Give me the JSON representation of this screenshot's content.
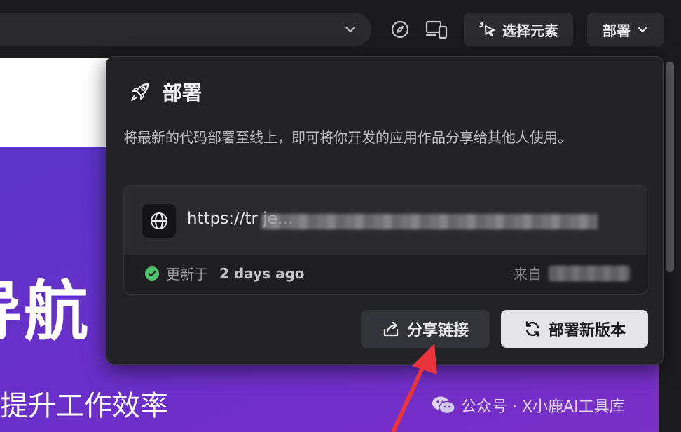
{
  "toolbar": {
    "select_element_label": "选择元素",
    "deploy_label": "部署"
  },
  "page": {
    "hero_title": "导航",
    "hero_subtitle": "提升工作效率"
  },
  "popover": {
    "title": "部署",
    "description": "将最新的代码部署至线上，即可将你开发的应用作品分享给其他人使用。",
    "url": "https://tr                                                      je…",
    "updated_label": "更新于",
    "updated_value": "2 days ago",
    "from_label": "来自",
    "share_button": "分享链接",
    "deploy_button": "部署新版本",
    "status_color": "#4fc36b"
  },
  "watermark": {
    "text": "公众号 · X小鹿AI工具库"
  },
  "colors": {
    "accent_arrow": "#e8343a",
    "hero_gradient_start": "#5a34c8",
    "hero_gradient_end": "#7a2fc7"
  }
}
